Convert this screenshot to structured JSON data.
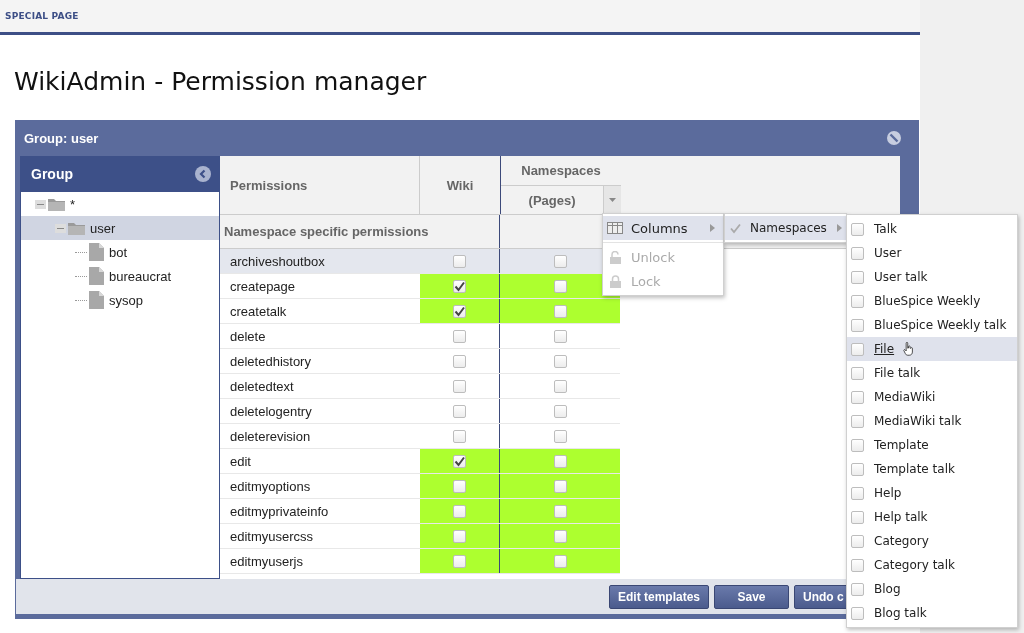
{
  "breadcrumb": "SPECIAL PAGE",
  "title": "WikiAdmin - Permission manager",
  "panel": {
    "title": "Group: user"
  },
  "group_tree": {
    "title": "Group",
    "nodes": [
      {
        "label": "*",
        "expanded": true,
        "selected": false,
        "children": [
          {
            "label": "user",
            "expanded": true,
            "selected": true,
            "children": [
              {
                "label": "bot",
                "selected": false
              },
              {
                "label": "bureaucrat",
                "selected": false
              },
              {
                "label": "sysop",
                "selected": false
              }
            ]
          }
        ]
      }
    ]
  },
  "grid": {
    "columns": {
      "permissions": "Permissions",
      "wiki": "Wiki",
      "group": "Namespaces",
      "pages": "(Pages)"
    },
    "section": "Namespace specific permissions",
    "rows": [
      {
        "name": "archiveshoutbox",
        "selected": true,
        "wiki": {
          "checked": false,
          "granted": false
        },
        "pages": {
          "checked": false,
          "granted": false
        }
      },
      {
        "name": "createpage",
        "selected": false,
        "wiki": {
          "checked": true,
          "granted": true
        },
        "pages": {
          "checked": false,
          "granted": true
        }
      },
      {
        "name": "createtalk",
        "selected": false,
        "wiki": {
          "checked": true,
          "granted": true
        },
        "pages": {
          "checked": false,
          "granted": true
        }
      },
      {
        "name": "delete",
        "selected": false,
        "wiki": {
          "checked": false,
          "granted": false
        },
        "pages": {
          "checked": false,
          "granted": false
        }
      },
      {
        "name": "deletedhistory",
        "selected": false,
        "wiki": {
          "checked": false,
          "granted": false
        },
        "pages": {
          "checked": false,
          "granted": false
        }
      },
      {
        "name": "deletedtext",
        "selected": false,
        "wiki": {
          "checked": false,
          "granted": false
        },
        "pages": {
          "checked": false,
          "granted": false
        }
      },
      {
        "name": "deletelogentry",
        "selected": false,
        "wiki": {
          "checked": false,
          "granted": false
        },
        "pages": {
          "checked": false,
          "granted": false
        }
      },
      {
        "name": "deleterevision",
        "selected": false,
        "wiki": {
          "checked": false,
          "granted": false
        },
        "pages": {
          "checked": false,
          "granted": false
        }
      },
      {
        "name": "edit",
        "selected": false,
        "wiki": {
          "checked": true,
          "granted": true
        },
        "pages": {
          "checked": false,
          "granted": true
        }
      },
      {
        "name": "editmyoptions",
        "selected": false,
        "wiki": {
          "checked": false,
          "granted": true
        },
        "pages": {
          "checked": false,
          "granted": true
        }
      },
      {
        "name": "editmyprivateinfo",
        "selected": false,
        "wiki": {
          "checked": false,
          "granted": true
        },
        "pages": {
          "checked": false,
          "granted": true
        }
      },
      {
        "name": "editmyusercss",
        "selected": false,
        "wiki": {
          "checked": false,
          "granted": true
        },
        "pages": {
          "checked": false,
          "granted": true
        }
      },
      {
        "name": "editmyuserjs",
        "selected": false,
        "wiki": {
          "checked": false,
          "granted": true
        },
        "pages": {
          "checked": false,
          "granted": true
        }
      }
    ]
  },
  "buttons": [
    "Edit templates",
    "Save",
    "Undo c"
  ],
  "column_menu": {
    "items": [
      {
        "kind": "submenu",
        "label": "Columns",
        "highlighted": true,
        "disabled": false
      },
      {
        "kind": "unlock",
        "label": "Unlock",
        "highlighted": false,
        "disabled": true
      },
      {
        "kind": "lock",
        "label": "Lock",
        "highlighted": false,
        "disabled": true
      }
    ]
  },
  "columns_submenu": {
    "items": [
      {
        "label": "Namespaces",
        "checked": true,
        "highlighted": true
      }
    ]
  },
  "namespaces_menu": {
    "items": [
      {
        "label": "Talk",
        "checked": false,
        "highlighted": false
      },
      {
        "label": "User",
        "checked": false,
        "highlighted": false
      },
      {
        "label": "User talk",
        "checked": false,
        "highlighted": false
      },
      {
        "label": "BlueSpice Weekly",
        "checked": false,
        "highlighted": false
      },
      {
        "label": "BlueSpice Weekly talk",
        "checked": false,
        "highlighted": false
      },
      {
        "label": "File",
        "checked": false,
        "highlighted": true
      },
      {
        "label": "File talk",
        "checked": false,
        "highlighted": false
      },
      {
        "label": "MediaWiki",
        "checked": false,
        "highlighted": false
      },
      {
        "label": "MediaWiki talk",
        "checked": false,
        "highlighted": false
      },
      {
        "label": "Template",
        "checked": false,
        "highlighted": false
      },
      {
        "label": "Template talk",
        "checked": false,
        "highlighted": false
      },
      {
        "label": "Help",
        "checked": false,
        "highlighted": false
      },
      {
        "label": "Help talk",
        "checked": false,
        "highlighted": false
      },
      {
        "label": "Category",
        "checked": false,
        "highlighted": false
      },
      {
        "label": "Category talk",
        "checked": false,
        "highlighted": false
      },
      {
        "label": "Blog",
        "checked": false,
        "highlighted": false
      },
      {
        "label": "Blog talk",
        "checked": false,
        "highlighted": false
      }
    ]
  }
}
